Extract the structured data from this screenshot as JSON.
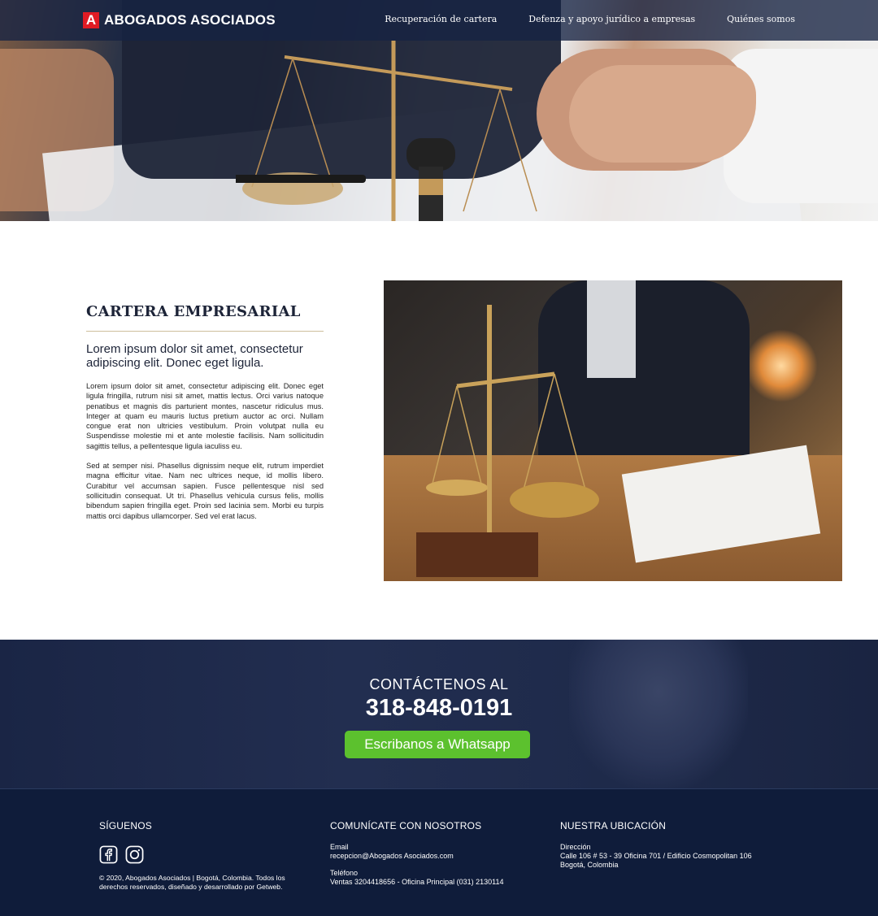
{
  "header": {
    "logo_mark": "A",
    "logo_text": "ABOGADOS ASOCIADOS",
    "nav": [
      "Recuperación de cartera",
      "Defenza y apoyo jurídico a empresas",
      "Quiénes somos"
    ]
  },
  "main": {
    "title": "CARTERA EMPRESARIAL",
    "lead": "Lorem ipsum dolor sit amet, consectetur adipiscing elit. Donec eget ligula.",
    "paragraphs": [
      "Lorem ipsum dolor sit amet, consectetur adipiscing elit. Donec eget ligula fringilla, rutrum nisi sit amet, mattis lectus. Orci varius natoque penatibus et magnis dis parturient montes, nascetur ridiculus mus. Integer at quam eu mauris luctus pretium auctor ac orci. Nullam congue erat non ultricies vestibulum. Proin volutpat nulla eu  Suspendisse molestie mi et ante molestie facilisis. Nam sollicitudin sagittis tellus, a pellentesque ligula iaculiss eu.",
      "Sed at semper nisi. Phasellus dignissim neque elit, rutrum imperdiet magna efficitur vitae. Nam nec ultrices neque, id mollis libero. Curabitur vel accumsan sapien. Fusce pellentesque nisl sed sollicitudin consequat. Ut tri. Phasellus vehicula cursus felis, mollis bibendum sapien fringilla eget. Proin sed lacinia sem. Morbi eu turpis mattis orci dapibus ullamcorper. Sed vel erat lacus."
    ]
  },
  "contact": {
    "title": "CONTÁCTENOS AL",
    "phone": "318-848-0191",
    "whatsapp_label": "Escribanos a Whatsapp"
  },
  "footer": {
    "follow": {
      "title": "SÍGUENOS",
      "icons": [
        "facebook-icon",
        "instagram-icon"
      ],
      "copyright": "© 2020, Abogados Asociados | Bogotá, Colombia. Todos los derechos reservados, diseñado y desarrollado por Getweb."
    },
    "contact": {
      "title": "COMUNÍCATE CON NOSOTROS",
      "email_label": "Email",
      "email": "recepcion@Abogados Asociados.com",
      "phone_label": "Teléfono",
      "phone": "Ventas 3204418656 - Oficina Principal (031) 2130114"
    },
    "location": {
      "title": "NUESTRA UBICACIÓN",
      "address_label": "Dirección",
      "address_line1": "Calle 106 # 53 - 39 Oficina 701 / Edificio Cosmopolitan 106",
      "address_line2": "Bogotá, Colombia"
    }
  },
  "colors": {
    "nav_bg": "#162242",
    "accent_red": "#e01b24",
    "whatsapp_green": "#5cc12e",
    "footer_bg": "#0f1c3a",
    "gold_divider": "#cdbf9c"
  }
}
